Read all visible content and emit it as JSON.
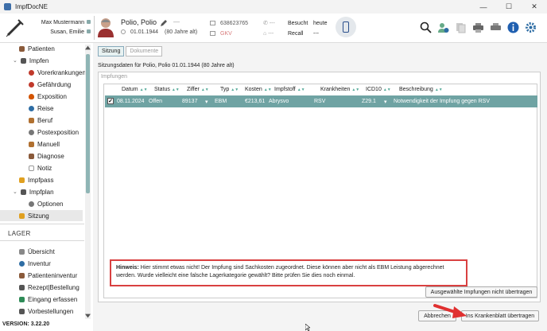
{
  "window": {
    "title": "ImpfDocNE",
    "controls": [
      "—",
      "☐",
      "✕"
    ]
  },
  "header": {
    "users": [
      "Max Mustermann",
      "Susan, Emilie"
    ],
    "patient": {
      "name": "Polio, Polio",
      "dob": "01.01.1944",
      "age": "(80 Jahre alt)"
    },
    "insurance": {
      "number": "638623765",
      "type": "GKV"
    },
    "phone": "---",
    "phone2": "---",
    "visit": {
      "besucht_label": "Besucht",
      "besucht_value": "heute",
      "recall_label": "Recall",
      "recall_value": "---"
    },
    "minus": "—"
  },
  "sidebar": {
    "items": [
      {
        "label": "Patienten",
        "icon": "patients-icon",
        "color": "#8a5a3a"
      },
      {
        "label": "Impfen",
        "icon": "syringe-icon",
        "color": "#555"
      },
      {
        "label": "Vorerkrankungen",
        "icon": "virus-icon",
        "color": "#c0392b"
      },
      {
        "label": "Gefährdung",
        "icon": "virus-icon",
        "color": "#c0392b"
      },
      {
        "label": "Exposition",
        "icon": "flame-icon",
        "color": "#d35400"
      },
      {
        "label": "Reise",
        "icon": "globe-icon",
        "color": "#2e6da4"
      },
      {
        "label": "Beruf",
        "icon": "hand-icon",
        "color": "#b07030"
      },
      {
        "label": "Postexposition",
        "icon": "gear-icon",
        "color": "#777"
      },
      {
        "label": "Manuell",
        "icon": "hand-icon",
        "color": "#b07030"
      },
      {
        "label": "Diagnose",
        "icon": "diagnosis-icon",
        "color": "#8a5a3a"
      },
      {
        "label": "Notiz",
        "icon": "note-icon",
        "color": "#999"
      },
      {
        "label": "Impfpass",
        "icon": "book-icon",
        "color": "#e0a020"
      },
      {
        "label": "Impfplan",
        "icon": "syringe-icon",
        "color": "#555"
      },
      {
        "label": "Optionen",
        "icon": "gear-icon",
        "color": "#777"
      },
      {
        "label": "Sitzung",
        "icon": "session-icon",
        "color": "#e0a020"
      }
    ],
    "lager_title": "LAGER",
    "lager_items": [
      {
        "label": "Übersicht",
        "icon": "overview-icon",
        "color": "#888"
      },
      {
        "label": "Inventur",
        "icon": "globe-icon",
        "color": "#2e6da4"
      },
      {
        "label": "Patienteninventur",
        "icon": "patients-icon",
        "color": "#8a5a3a"
      },
      {
        "label": "Rezept|Bestellung",
        "icon": "cart-icon",
        "color": "#555"
      },
      {
        "label": "Eingang erfassen",
        "icon": "box-icon",
        "color": "#2e8b57"
      },
      {
        "label": "Vorbestellungen",
        "icon": "cart-icon",
        "color": "#555"
      }
    ],
    "version": "VERSION: 3.22.20"
  },
  "main": {
    "tabs": [
      "Sitzung",
      "Dokumente"
    ],
    "subtitle": "Sitzungsdaten für Polio, Polio 01.01.1944 (80 Jahre alt)",
    "panel_label": "Impfungen",
    "columns": [
      "Datum",
      "Status",
      "Ziffer",
      "Typ",
      "Kosten",
      "Impfstoff",
      "Krankheiten",
      "ICD10",
      "Beschreibung"
    ],
    "rows": [
      {
        "checked": "✓",
        "datum": "08.11.2024",
        "status": "Offen",
        "ziffer": "89137",
        "ziffer_dropdown": "▾",
        "typ": "EBM",
        "kosten": "€213,61",
        "impfstoff": "Abrysvo",
        "krankheiten": "RSV",
        "icd10": "Z29.1",
        "icd10_dropdown": "▾",
        "beschreibung": "Notwendigkeit der Impfung gegen RSV"
      }
    ],
    "hint_label": "Hinweis:",
    "hint_text": "Hier stimmt etwas nicht! Der Impfung sind Sachkosten zugeordnet. Diese können aber nicht als EBM Leistung abgerechnet werden. Wurde vielleicht eine falsche Lagerkategorie gewählt? Bitte prüfen Sie dies noch einmal.",
    "buttons": {
      "not_transfer": "Ausgewählte Impfungen nicht übertragen",
      "cancel": "Abbrechen",
      "transfer": "Ins Krankenblatt übertragen"
    }
  },
  "colors": {
    "accent": "#6fa3a3",
    "warning": "#d94040",
    "arrow": "#e03030"
  }
}
